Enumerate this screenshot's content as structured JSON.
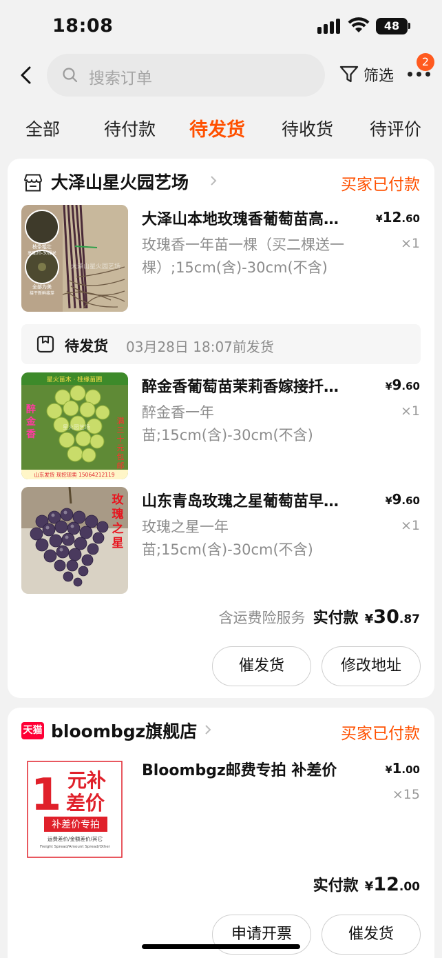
{
  "status_bar": {
    "time": "18:08",
    "battery": "48"
  },
  "header": {
    "search_placeholder": "搜索订单",
    "filter_label": "筛选",
    "notification_count": "2"
  },
  "tabs": [
    {
      "label": "全部",
      "active": false
    },
    {
      "label": "待付款",
      "active": false
    },
    {
      "label": "待发货",
      "active": true
    },
    {
      "label": "待收货",
      "active": false
    },
    {
      "label": "待评价",
      "active": false
    }
  ],
  "orders": [
    {
      "shop_name": "大泽山星火园艺场",
      "status": "买家已付款",
      "items": [
        {
          "title": "大泽山本地玫瑰香葡萄苗高…",
          "spec": "玫瑰香一年苗一棵（买二棵送一棵）;15cm(含)-30cm(不含)",
          "price_yen": "¥",
          "price_int": "12",
          "price_cents": ".60",
          "qty": "×1"
        },
        {
          "title": "醉金香葡萄苗茉莉香嫁接扦…",
          "spec": "醉金香一年苗;15cm(含)-30cm(不含)",
          "price_yen": "¥",
          "price_int": "9",
          "price_cents": ".60",
          "qty": "×1"
        },
        {
          "title": "山东青岛玫瑰之星葡萄苗早…",
          "spec": "玫瑰之星一年苗;15cm(含)-30cm(不含)",
          "price_yen": "¥",
          "price_int": "9",
          "price_cents": ".60",
          "qty": "×1"
        }
      ],
      "shipping": {
        "status": "待发货",
        "deadline": "03月28日 18:07前发货"
      },
      "total": {
        "note": "含运费险服务",
        "label": "实付款",
        "yen": "¥",
        "int": "30",
        "cents": ".87"
      },
      "buttons": [
        "催发货",
        "修改地址"
      ],
      "thumb_text": {
        "grape1": {
          "tag1": "枝条粗壮",
          "tag1b": "高度20-30厘米",
          "tag2": "全部为美",
          "tag2b": "接干新鲜接芽",
          "watermark": "大泽山星火园艺场"
        },
        "grape2": {
          "banner": "星火苗木 · 桂缘苗圃",
          "side": [
            "醉",
            "金",
            "香"
          ],
          "side2": [
            "满",
            "三",
            "十",
            "元",
            "包",
            "邮"
          ],
          "footer": "山东发货 现挖现卖 15064212119",
          "watermark": "星火园艺场"
        },
        "grape3": {
          "side": [
            "玫",
            "瑰",
            "之",
            "星"
          ]
        }
      }
    },
    {
      "shop_name": "bloombgz旗舰店",
      "badge": "天猫",
      "status": "买家已付款",
      "items": [
        {
          "title": "Bloombgz邮费专拍 补差价",
          "price_yen": "¥",
          "price_int": "1",
          "price_cents": ".00",
          "qty": "×15",
          "thumb": {
            "big": "1",
            "line1": "元补",
            "line2": "差价",
            "band": "补差价专拍",
            "small": "运费差价/金额差价/其它",
            "eng": "Freight Spread/Amount Spread/Other"
          }
        }
      ],
      "total": {
        "label": "实付款",
        "yen": "¥",
        "int": "12",
        "cents": ".00"
      },
      "buttons": [
        "申请开票",
        "催发货"
      ]
    }
  ],
  "colors": {
    "accent": "#ff5000",
    "tmall_red": "#ff0036"
  }
}
